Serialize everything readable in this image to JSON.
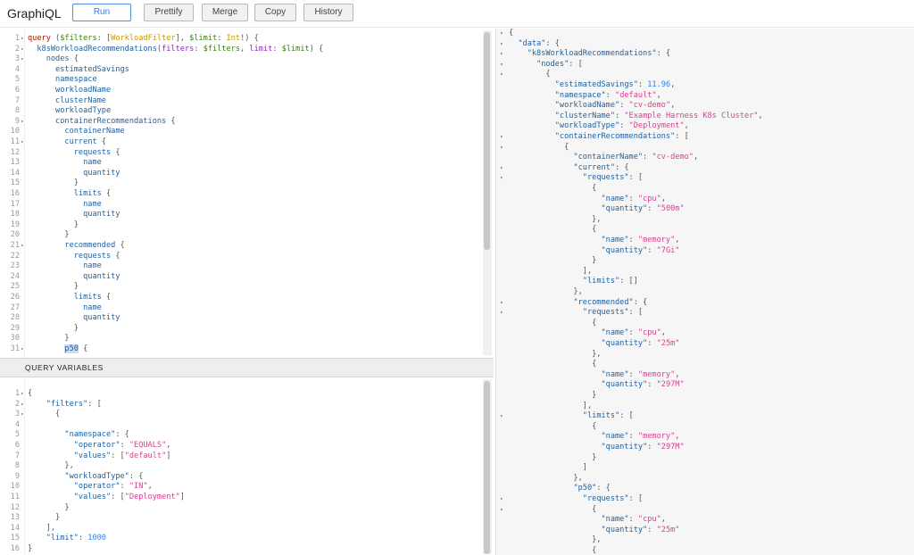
{
  "toolbar": {
    "logo": "GraphiQL",
    "run": "Run",
    "prettify": "Prettify",
    "merge": "Merge",
    "copy": "Copy",
    "history": "History"
  },
  "vars_header": "QUERY VARIABLES",
  "query_lines": [
    [
      [
        "kw",
        "query"
      ],
      [
        "pun",
        " ("
      ],
      [
        "var",
        "$filters"
      ],
      [
        "pun",
        ": ["
      ],
      [
        "typ",
        "WorkloadFilter"
      ],
      [
        "pun",
        "], "
      ],
      [
        "var",
        "$limit"
      ],
      [
        "pun",
        ": "
      ],
      [
        "typ",
        "Int"
      ],
      [
        "pun",
        "!) {"
      ]
    ],
    [
      [
        "pun",
        "  "
      ],
      [
        "fld",
        "k8sWorkloadRecommendations"
      ],
      [
        "pun",
        "("
      ],
      [
        "arg",
        "filters"
      ],
      [
        "pun",
        ": "
      ],
      [
        "var",
        "$filters"
      ],
      [
        "pun",
        ", "
      ],
      [
        "arg",
        "limit"
      ],
      [
        "pun",
        ": "
      ],
      [
        "var",
        "$limit"
      ],
      [
        "pun",
        ") {"
      ]
    ],
    [
      [
        "pun",
        "    "
      ],
      [
        "fld",
        "nodes"
      ],
      [
        "pun",
        " {"
      ]
    ],
    [
      [
        "pun",
        "      "
      ],
      [
        "fld",
        "estimatedSavings"
      ]
    ],
    [
      [
        "pun",
        "      "
      ],
      [
        "fld",
        "namespace"
      ]
    ],
    [
      [
        "pun",
        "      "
      ],
      [
        "fld",
        "workloadName"
      ]
    ],
    [
      [
        "pun",
        "      "
      ],
      [
        "fld",
        "clusterName"
      ]
    ],
    [
      [
        "pun",
        "      "
      ],
      [
        "fld",
        "workloadType"
      ]
    ],
    [
      [
        "pun",
        "      "
      ],
      [
        "fld",
        "containerRecommendations"
      ],
      [
        "pun",
        " {"
      ]
    ],
    [
      [
        "pun",
        "        "
      ],
      [
        "fld",
        "containerName"
      ]
    ],
    [
      [
        "pun",
        "        "
      ],
      [
        "fld",
        "current"
      ],
      [
        "pun",
        " {"
      ]
    ],
    [
      [
        "pun",
        "          "
      ],
      [
        "fld",
        "requests"
      ],
      [
        "pun",
        " {"
      ]
    ],
    [
      [
        "pun",
        "            "
      ],
      [
        "fld",
        "name"
      ]
    ],
    [
      [
        "pun",
        "            "
      ],
      [
        "fld",
        "quantity"
      ]
    ],
    [
      [
        "pun",
        "          }"
      ]
    ],
    [
      [
        "pun",
        "          "
      ],
      [
        "fld",
        "limits"
      ],
      [
        "pun",
        " {"
      ]
    ],
    [
      [
        "pun",
        "            "
      ],
      [
        "fld",
        "name"
      ]
    ],
    [
      [
        "pun",
        "            "
      ],
      [
        "fld",
        "quantity"
      ]
    ],
    [
      [
        "pun",
        "          }"
      ]
    ],
    [
      [
        "pun",
        "        }"
      ]
    ],
    [
      [
        "pun",
        "        "
      ],
      [
        "fld",
        "recommended"
      ],
      [
        "pun",
        " {"
      ]
    ],
    [
      [
        "pun",
        "          "
      ],
      [
        "fld",
        "requests"
      ],
      [
        "pun",
        " {"
      ]
    ],
    [
      [
        "pun",
        "            "
      ],
      [
        "fld",
        "name"
      ]
    ],
    [
      [
        "pun",
        "            "
      ],
      [
        "fld",
        "quantity"
      ]
    ],
    [
      [
        "pun",
        "          }"
      ]
    ],
    [
      [
        "pun",
        "          "
      ],
      [
        "fld",
        "limits"
      ],
      [
        "pun",
        " {"
      ]
    ],
    [
      [
        "pun",
        "            "
      ],
      [
        "fld",
        "name"
      ]
    ],
    [
      [
        "pun",
        "            "
      ],
      [
        "fld",
        "quantity"
      ]
    ],
    [
      [
        "pun",
        "          }"
      ]
    ],
    [
      [
        "pun",
        "        }"
      ]
    ],
    [
      [
        "pun",
        "        "
      ],
      [
        "fld hl",
        "p50"
      ],
      [
        "pun",
        " {"
      ]
    ]
  ],
  "query_folds": [
    1,
    2,
    3,
    9,
    11,
    21,
    31
  ],
  "vars_lines": [
    [
      [
        "pun",
        "{"
      ]
    ],
    [
      [
        "pun",
        "    "
      ],
      [
        "prop",
        "\"filters\""
      ],
      [
        "pun",
        ": ["
      ]
    ],
    [
      [
        "pun",
        "      {"
      ]
    ],
    [
      [
        "pun",
        ""
      ]
    ],
    [
      [
        "pun",
        "        "
      ],
      [
        "prop",
        "\"namespace\""
      ],
      [
        "pun",
        ": {"
      ]
    ],
    [
      [
        "pun",
        "          "
      ],
      [
        "prop",
        "\"operator\""
      ],
      [
        "pun",
        ": "
      ],
      [
        "str",
        "\"EQUALS\""
      ],
      [
        "pun",
        ","
      ]
    ],
    [
      [
        "pun",
        "          "
      ],
      [
        "prop",
        "\"values\""
      ],
      [
        "pun",
        ": ["
      ],
      [
        "str",
        "\"default\""
      ],
      [
        "pun",
        "]"
      ]
    ],
    [
      [
        "pun",
        "        },"
      ]
    ],
    [
      [
        "pun",
        "        "
      ],
      [
        "prop",
        "\"workloadType\""
      ],
      [
        "pun",
        ": {"
      ]
    ],
    [
      [
        "pun",
        "          "
      ],
      [
        "prop",
        "\"operator\""
      ],
      [
        "pun",
        ": "
      ],
      [
        "str",
        "\"IN\""
      ],
      [
        "pun",
        ","
      ]
    ],
    [
      [
        "pun",
        "          "
      ],
      [
        "prop",
        "\"values\""
      ],
      [
        "pun",
        ": ["
      ],
      [
        "str",
        "\"Deployment\""
      ],
      [
        "pun",
        "]"
      ]
    ],
    [
      [
        "pun",
        "        }"
      ]
    ],
    [
      [
        "pun",
        "      }"
      ]
    ],
    [
      [
        "pun",
        "    ],"
      ]
    ],
    [
      [
        "pun",
        "    "
      ],
      [
        "prop",
        "\"limit\""
      ],
      [
        "pun",
        ": "
      ],
      [
        "num",
        "1000"
      ]
    ],
    [
      [
        "pun",
        "}"
      ]
    ]
  ],
  "vars_folds": [
    1,
    2,
    3
  ],
  "result_lines": [
    [
      [
        "pun",
        "{"
      ]
    ],
    [
      [
        "pun",
        "  "
      ],
      [
        "prop",
        "\"data\""
      ],
      [
        "pun",
        ": {"
      ]
    ],
    [
      [
        "pun",
        "    "
      ],
      [
        "prop",
        "\"k8sWorkloadRecommendations\""
      ],
      [
        "pun",
        ": {"
      ]
    ],
    [
      [
        "pun",
        "      "
      ],
      [
        "prop",
        "\"nodes\""
      ],
      [
        "pun",
        ": ["
      ]
    ],
    [
      [
        "pun",
        "        {"
      ]
    ],
    [
      [
        "pun",
        "          "
      ],
      [
        "prop",
        "\"estimatedSavings\""
      ],
      [
        "pun",
        ": "
      ],
      [
        "num",
        "11.96"
      ],
      [
        "pun",
        ","
      ]
    ],
    [
      [
        "pun",
        "          "
      ],
      [
        "prop",
        "\"namespace\""
      ],
      [
        "pun",
        ": "
      ],
      [
        "str",
        "\"default\""
      ],
      [
        "pun",
        ","
      ]
    ],
    [
      [
        "pun",
        "          "
      ],
      [
        "prop",
        "\"workloadName\""
      ],
      [
        "pun",
        ": "
      ],
      [
        "str",
        "\"cv-demo\""
      ],
      [
        "pun",
        ","
      ]
    ],
    [
      [
        "pun",
        "          "
      ],
      [
        "prop",
        "\"clusterName\""
      ],
      [
        "pun",
        ": "
      ],
      [
        "str",
        "\"Example Harness K8s Cluster\""
      ],
      [
        "pun",
        ","
      ]
    ],
    [
      [
        "pun",
        "          "
      ],
      [
        "prop",
        "\"workloadType\""
      ],
      [
        "pun",
        ": "
      ],
      [
        "str",
        "\"Deployment\""
      ],
      [
        "pun",
        ","
      ]
    ],
    [
      [
        "pun",
        "          "
      ],
      [
        "prop",
        "\"containerRecommendations\""
      ],
      [
        "pun",
        ": ["
      ]
    ],
    [
      [
        "pun",
        "            {"
      ]
    ],
    [
      [
        "pun",
        "              "
      ],
      [
        "prop",
        "\"containerName\""
      ],
      [
        "pun",
        ": "
      ],
      [
        "str",
        "\"cv-demo\""
      ],
      [
        "pun",
        ","
      ]
    ],
    [
      [
        "pun",
        "              "
      ],
      [
        "prop",
        "\"current\""
      ],
      [
        "pun",
        ": {"
      ]
    ],
    [
      [
        "pun",
        "                "
      ],
      [
        "prop",
        "\"requests\""
      ],
      [
        "pun",
        ": ["
      ]
    ],
    [
      [
        "pun",
        "                  {"
      ]
    ],
    [
      [
        "pun",
        "                    "
      ],
      [
        "prop",
        "\"name\""
      ],
      [
        "pun",
        ": "
      ],
      [
        "str",
        "\"cpu\""
      ],
      [
        "pun",
        ","
      ]
    ],
    [
      [
        "pun",
        "                    "
      ],
      [
        "prop",
        "\"quantity\""
      ],
      [
        "pun",
        ": "
      ],
      [
        "str",
        "\"500m\""
      ]
    ],
    [
      [
        "pun",
        "                  },"
      ]
    ],
    [
      [
        "pun",
        "                  {"
      ]
    ],
    [
      [
        "pun",
        "                    "
      ],
      [
        "prop",
        "\"name\""
      ],
      [
        "pun",
        ": "
      ],
      [
        "str",
        "\"memory\""
      ],
      [
        "pun",
        ","
      ]
    ],
    [
      [
        "pun",
        "                    "
      ],
      [
        "prop",
        "\"quantity\""
      ],
      [
        "pun",
        ": "
      ],
      [
        "str",
        "\"7Gi\""
      ]
    ],
    [
      [
        "pun",
        "                  }"
      ]
    ],
    [
      [
        "pun",
        "                ],"
      ]
    ],
    [
      [
        "pun",
        "                "
      ],
      [
        "prop",
        "\"limits\""
      ],
      [
        "pun",
        ": []"
      ]
    ],
    [
      [
        "pun",
        "              },"
      ]
    ],
    [
      [
        "pun",
        "              "
      ],
      [
        "prop",
        "\"recommended\""
      ],
      [
        "pun",
        ": {"
      ]
    ],
    [
      [
        "pun",
        "                "
      ],
      [
        "prop",
        "\"requests\""
      ],
      [
        "pun",
        ": ["
      ]
    ],
    [
      [
        "pun",
        "                  {"
      ]
    ],
    [
      [
        "pun",
        "                    "
      ],
      [
        "prop",
        "\"name\""
      ],
      [
        "pun",
        ": "
      ],
      [
        "str",
        "\"cpu\""
      ],
      [
        "pun",
        ","
      ]
    ],
    [
      [
        "pun",
        "                    "
      ],
      [
        "prop",
        "\"quantity\""
      ],
      [
        "pun",
        ": "
      ],
      [
        "str",
        "\"25m\""
      ]
    ],
    [
      [
        "pun",
        "                  },"
      ]
    ],
    [
      [
        "pun",
        "                  {"
      ]
    ],
    [
      [
        "pun",
        "                    "
      ],
      [
        "prop",
        "\"name\""
      ],
      [
        "pun",
        ": "
      ],
      [
        "str",
        "\"memory\""
      ],
      [
        "pun",
        ","
      ]
    ],
    [
      [
        "pun",
        "                    "
      ],
      [
        "prop",
        "\"quantity\""
      ],
      [
        "pun",
        ": "
      ],
      [
        "str",
        "\"297M\""
      ]
    ],
    [
      [
        "pun",
        "                  }"
      ]
    ],
    [
      [
        "pun",
        "                ],"
      ]
    ],
    [
      [
        "pun",
        "                "
      ],
      [
        "prop",
        "\"limits\""
      ],
      [
        "pun",
        ": ["
      ]
    ],
    [
      [
        "pun",
        "                  {"
      ]
    ],
    [
      [
        "pun",
        "                    "
      ],
      [
        "prop",
        "\"name\""
      ],
      [
        "pun",
        ": "
      ],
      [
        "str",
        "\"memory\""
      ],
      [
        "pun",
        ","
      ]
    ],
    [
      [
        "pun",
        "                    "
      ],
      [
        "prop",
        "\"quantity\""
      ],
      [
        "pun",
        ": "
      ],
      [
        "str",
        "\"297M\""
      ]
    ],
    [
      [
        "pun",
        "                  }"
      ]
    ],
    [
      [
        "pun",
        "                ]"
      ]
    ],
    [
      [
        "pun",
        "              },"
      ]
    ],
    [
      [
        "pun",
        "              "
      ],
      [
        "prop",
        "\"p50\""
      ],
      [
        "pun",
        ": {"
      ]
    ],
    [
      [
        "pun",
        "                "
      ],
      [
        "prop",
        "\"requests\""
      ],
      [
        "pun",
        ": ["
      ]
    ],
    [
      [
        "pun",
        "                  {"
      ]
    ],
    [
      [
        "pun",
        "                    "
      ],
      [
        "prop",
        "\"name\""
      ],
      [
        "pun",
        ": "
      ],
      [
        "str",
        "\"cpu\""
      ],
      [
        "pun",
        ","
      ]
    ],
    [
      [
        "pun",
        "                    "
      ],
      [
        "prop",
        "\"quantity\""
      ],
      [
        "pun",
        ": "
      ],
      [
        "str",
        "\"25m\""
      ]
    ],
    [
      [
        "pun",
        "                  },"
      ]
    ],
    [
      [
        "pun",
        "                  {"
      ]
    ]
  ],
  "result_folds": [
    1,
    2,
    3,
    4,
    5,
    11,
    12,
    14,
    15,
    27,
    28,
    38,
    46,
    47
  ]
}
